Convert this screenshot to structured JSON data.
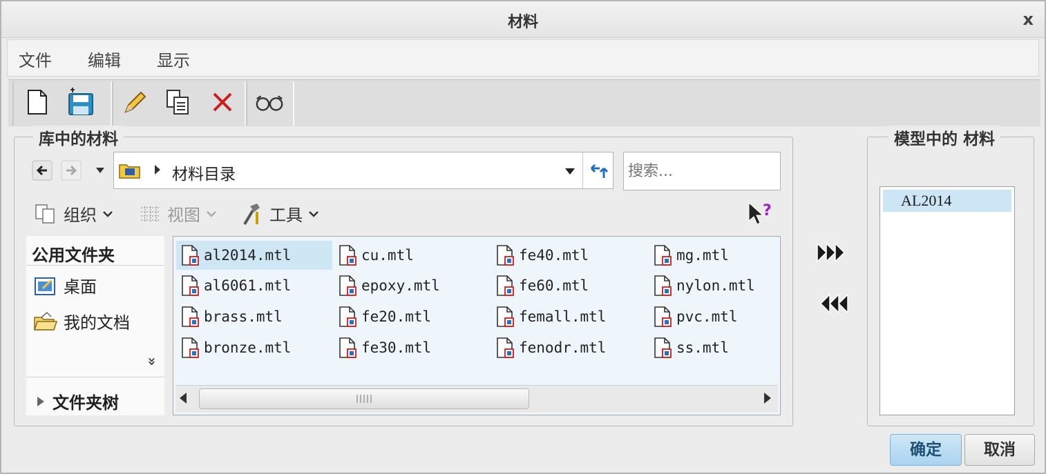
{
  "window": {
    "title": "材料",
    "close_glyph": "x"
  },
  "menu": [
    "文件",
    "编辑",
    "显示"
  ],
  "toolbar": [
    "new-icon",
    "save-icon",
    "edit-icon",
    "copy-icon",
    "delete-icon",
    "view-icon"
  ],
  "library": {
    "legend": "库中的材料",
    "address": {
      "path": "材料目录"
    },
    "search": {
      "placeholder": "搜索..."
    },
    "commands": {
      "organize": "组织",
      "view": "视图",
      "tools": "工具"
    },
    "nav_pane": {
      "heading": "公用文件夹",
      "links": [
        "桌面",
        "我的文档"
      ],
      "more_glyph": "»",
      "tree": "文件夹树"
    },
    "files": [
      "al2014.mtl",
      "al6061.mtl",
      "brass.mtl",
      "bronze.mtl",
      "cu.mtl",
      "epoxy.mtl",
      "fe20.mtl",
      "fe30.mtl",
      "fe40.mtl",
      "fe60.mtl",
      "femall.mtl",
      "fenodr.mtl",
      "mg.mtl",
      "nylon.mtl",
      "pvc.mtl",
      "ss.mtl"
    ],
    "selected_file": "al2014.mtl"
  },
  "model": {
    "legend": "模型中的 材料",
    "items": [
      "AL2014"
    ]
  },
  "buttons": {
    "ok": "确定",
    "cancel": "取消"
  }
}
